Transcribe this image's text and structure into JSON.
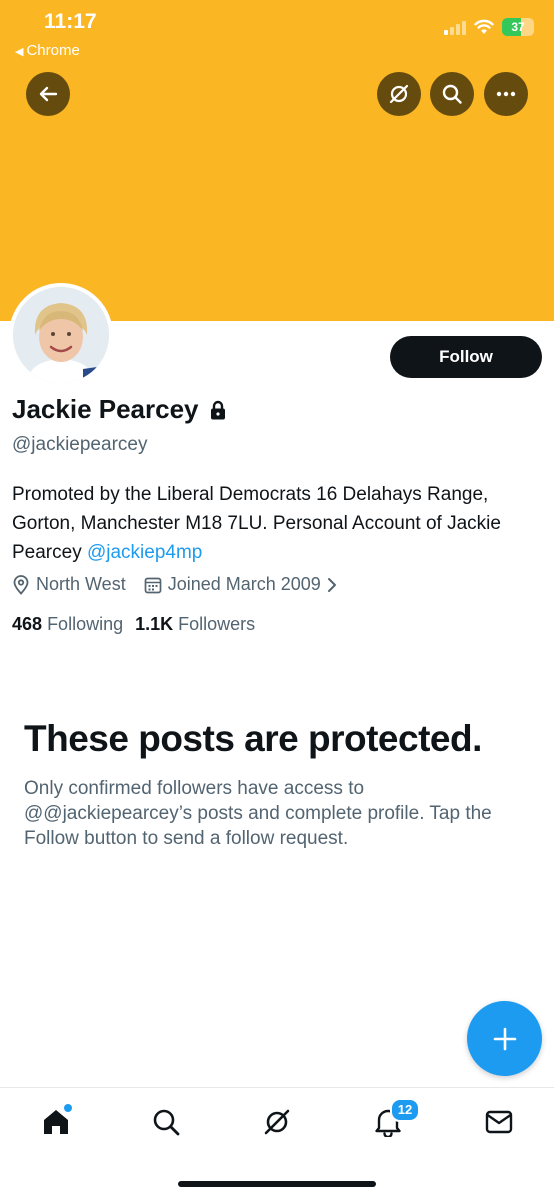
{
  "status_bar": {
    "time": "11:17",
    "back_app": "Chrome",
    "battery": "37"
  },
  "profile": {
    "name": "Jackie Pearcey",
    "handle": "@jackiepearcey",
    "bio_text": "Promoted by the Liberal Democrats 16 Delahays Range, Gorton, Manchester M18 7LU. Personal Account of Jackie Pearcey ",
    "bio_mention": "@jackiep4mp",
    "location": "North West",
    "joined": "Joined March 2009",
    "following_count": "468",
    "following_label": "Following",
    "followers_count": "1.1K",
    "followers_label": "Followers",
    "follow_button": "Follow"
  },
  "protected": {
    "title": "These posts are protected.",
    "body": "Only confirmed followers have access to @@jackiepearcey’s posts and complete profile. Tap the Follow button to send a follow request."
  },
  "tabbar": {
    "notifications_badge": "12"
  },
  "icons": [
    "back-arrow-icon",
    "grok-icon",
    "search-icon",
    "more-icon",
    "lock-icon",
    "location-icon",
    "calendar-icon",
    "chevron-right-icon",
    "plus-icon",
    "home-icon",
    "notifications-icon",
    "messages-icon"
  ],
  "colors": {
    "banner": "#fbb623",
    "accent": "#1d9bf0",
    "text": "#0f1419",
    "secondary": "#536471"
  }
}
